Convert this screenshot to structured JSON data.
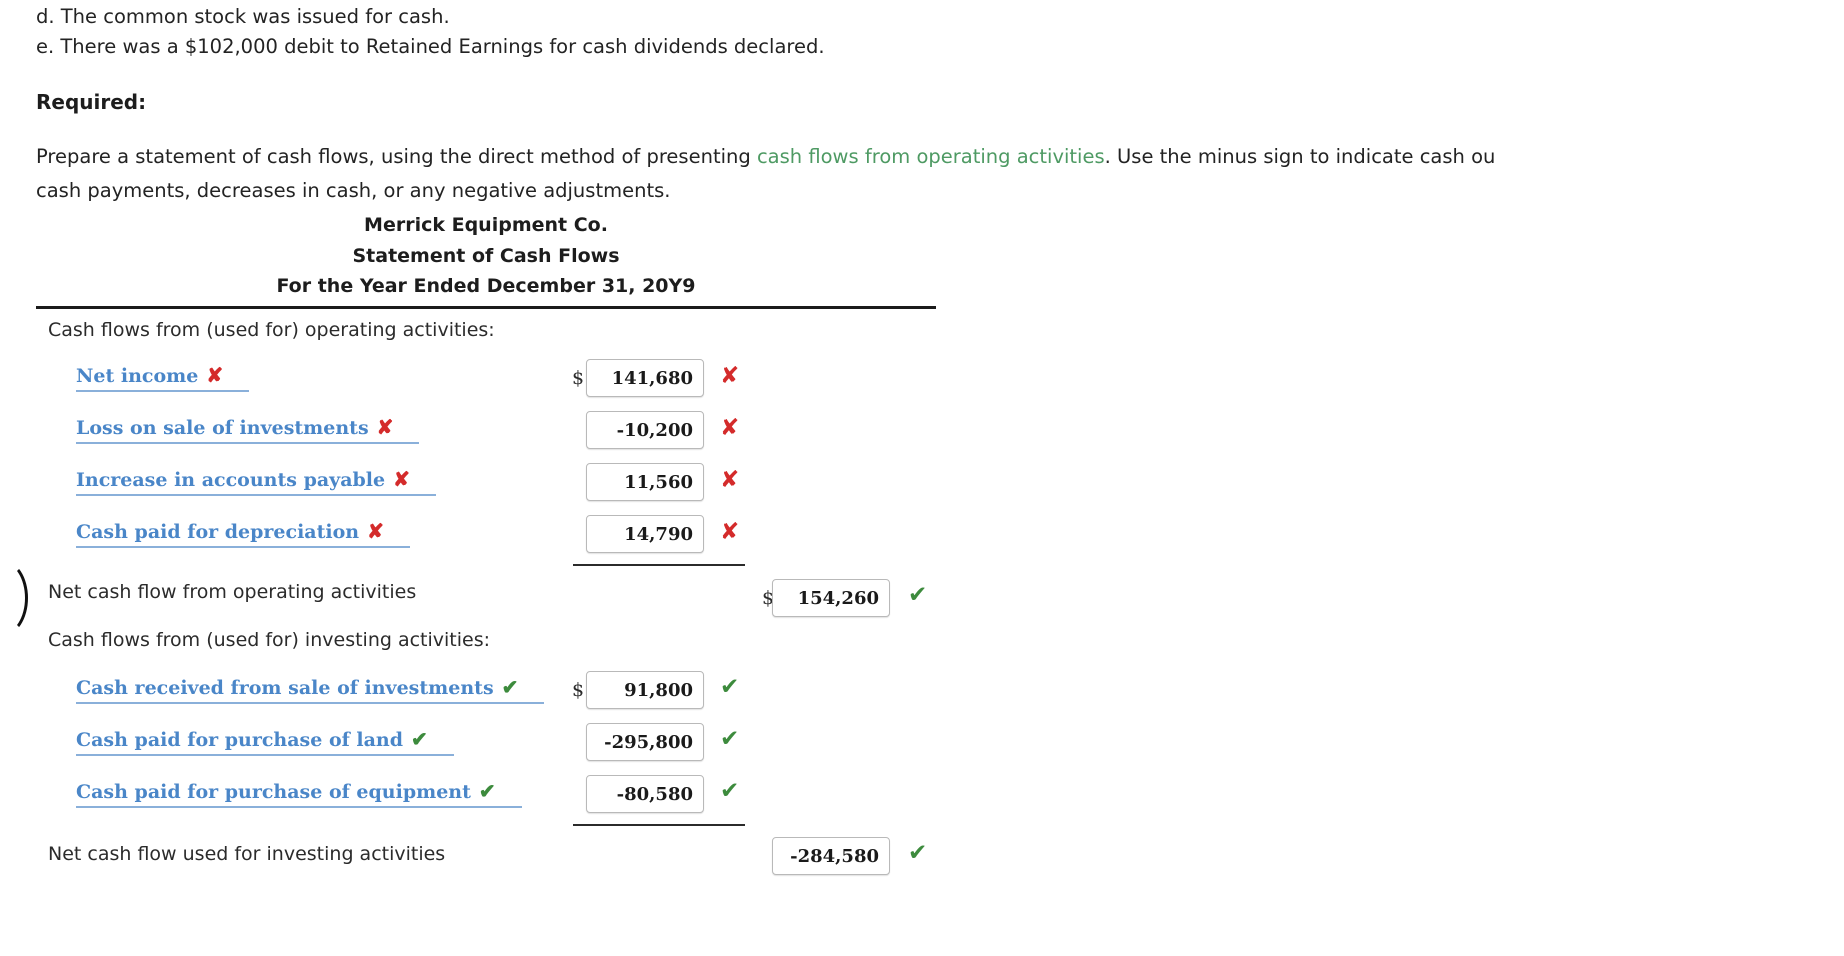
{
  "intro": {
    "line_d": "d. The common stock was issued for cash.",
    "line_e": "e. There was a $102,000 debit to Retained Earnings for cash dividends declared.",
    "required_label": "Required:",
    "prepare_part1": "Prepare a statement of cash flows, using the direct method of presenting ",
    "prepare_link": "cash flows from operating activities",
    "prepare_part2": ". Use the minus sign to indicate cash ou",
    "prepare_line2": "cash payments, decreases in cash, or any negative adjustments."
  },
  "statement": {
    "company": "Merrick Equipment Co.",
    "title": "Statement of Cash Flows",
    "period": "For the Year Ended December 31, 20Y9",
    "sections": [
      {
        "header": "Cash flows from (used for) operating activities:",
        "rows": [
          {
            "label": "Net income",
            "label_mark": "x",
            "dollar": "$",
            "value": "141,680",
            "value_mark": "x"
          },
          {
            "label": "Loss on sale of investments",
            "label_mark": "x",
            "dollar": "",
            "value": "-10,200",
            "value_mark": "x"
          },
          {
            "label": "Increase in accounts payable",
            "label_mark": "x",
            "dollar": "",
            "value": "11,560",
            "value_mark": "x"
          },
          {
            "label": "Cash paid for depreciation",
            "label_mark": "x",
            "dollar": "",
            "value": "14,790",
            "value_mark": "x"
          }
        ],
        "total": {
          "label": "Net cash flow from operating activities",
          "dollar": "$",
          "value": "154,260",
          "mark": "v"
        }
      },
      {
        "header": "Cash flows from (used for) investing activities:",
        "rows": [
          {
            "label": "Cash received from sale of investments",
            "label_mark": "v",
            "dollar": "$",
            "value": "91,800",
            "value_mark": "v"
          },
          {
            "label": "Cash paid for purchase of land",
            "label_mark": "v",
            "dollar": "",
            "value": "-295,800",
            "value_mark": "v"
          },
          {
            "label": "Cash paid for purchase of equipment",
            "label_mark": "v",
            "dollar": "",
            "value": "-80,580",
            "value_mark": "v"
          }
        ],
        "total": {
          "label": "Net cash flow used for investing activities",
          "dollar": "",
          "value": "-284,580",
          "mark": "v"
        }
      }
    ]
  },
  "marks": {
    "x": "✘",
    "v": "✔"
  },
  "colors": {
    "link": "#4a86c8",
    "green": "#4e9a63",
    "error": "#d42b2b",
    "ok": "#3d8b3d"
  }
}
